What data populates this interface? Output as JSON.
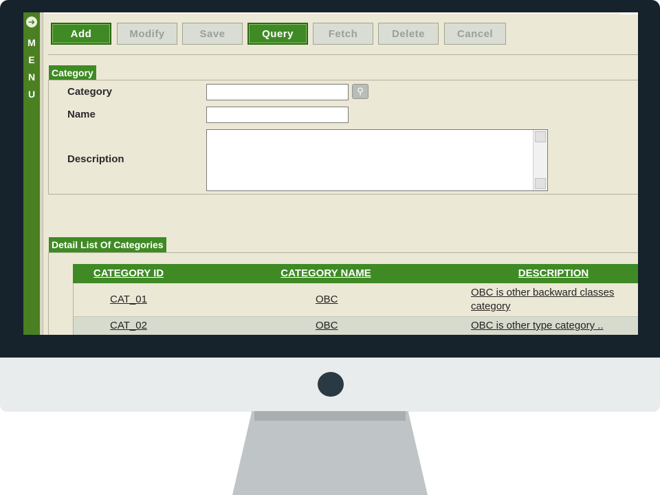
{
  "menu": {
    "letters": [
      "M",
      "E",
      "N",
      "U"
    ],
    "icon": "arrow-circle-icon"
  },
  "toolbar": {
    "buttons": [
      {
        "label": "Add",
        "state": "active"
      },
      {
        "label": "Modify",
        "state": "disabled"
      },
      {
        "label": "Save",
        "state": "disabled"
      },
      {
        "label": "Query",
        "state": "active"
      },
      {
        "label": "Fetch",
        "state": "disabled"
      },
      {
        "label": "Delete",
        "state": "disabled"
      },
      {
        "label": "Cancel",
        "state": "disabled"
      }
    ]
  },
  "category_section": {
    "title": "Category",
    "fields": {
      "category": {
        "label": "Category",
        "value": ""
      },
      "name": {
        "label": "Name",
        "value": ""
      },
      "description": {
        "label": "Description",
        "value": ""
      }
    },
    "lookup_icon": "search-icon"
  },
  "list_section": {
    "title": "Detail List Of Categories",
    "columns": [
      "CATEGORY ID",
      "CATEGORY NAME",
      "DESCRIPTION"
    ],
    "rows": [
      {
        "id": "CAT_01",
        "name": "OBC",
        "description_line1": "OBC is other backward classes",
        "description_line2": "category"
      },
      {
        "id": "CAT_02",
        "name": "OBC",
        "description_line1": "OBC is other type category ..",
        "description_line2": ""
      }
    ]
  },
  "colors": {
    "accent": "#3f8a25",
    "screen_bg": "#ece8d6",
    "bezel": "#16222c"
  }
}
